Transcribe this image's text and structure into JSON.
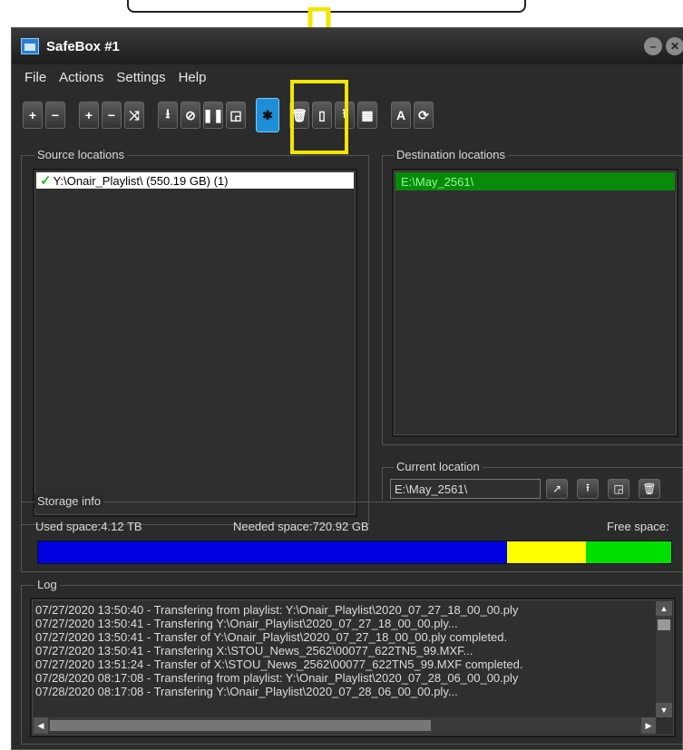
{
  "window": {
    "title": "SafeBox #1"
  },
  "menu": [
    "File",
    "Actions",
    "Settings",
    "Help"
  ],
  "toolbar": {
    "buttons": [
      {
        "icon": "plus-icon",
        "glyph": "+"
      },
      {
        "icon": "minus-icon",
        "glyph": "−"
      },
      {
        "icon": "plus-icon",
        "glyph": "+"
      },
      {
        "icon": "minus-icon",
        "glyph": "−"
      },
      {
        "icon": "shuffle-icon",
        "glyph": "⤨"
      },
      {
        "icon": "download-icon",
        "glyph": "⭳"
      },
      {
        "icon": "stop-icon",
        "glyph": "⊘"
      },
      {
        "icon": "pause-icon",
        "glyph": "❚❚"
      },
      {
        "icon": "window-icon",
        "glyph": "◲"
      },
      {
        "icon": "settings-star-icon",
        "glyph": "✱"
      },
      {
        "icon": "trash-icon",
        "glyph": "🗑"
      },
      {
        "icon": "document-icon",
        "glyph": "▯"
      },
      {
        "icon": "upload-icon",
        "glyph": "⭱"
      },
      {
        "icon": "grid-icon",
        "glyph": "▦"
      },
      {
        "icon": "font-icon",
        "glyph": "A"
      },
      {
        "icon": "refresh-icon",
        "glyph": "⟳"
      }
    ],
    "highlight_color": "#f2e600",
    "active_color": "#1e8fd6"
  },
  "source": {
    "label": "Source locations",
    "items": [
      "Y:\\Onair_Playlist\\ (550.19 GB) (1)"
    ]
  },
  "destination": {
    "label": "Destination locations",
    "items": [
      "E:\\May_2561\\"
    ]
  },
  "current": {
    "label": "Current location",
    "value": "E:\\May_2561\\"
  },
  "storage": {
    "label": "Storage info",
    "used": "Used space:4.12 TB",
    "needed": "Needed space:720.92 GB",
    "free": "Free space:",
    "bar": [
      {
        "color": "#0000e0",
        "fraction": 0.74
      },
      {
        "color": "#ffff00",
        "fraction": 0.126
      },
      {
        "color": "#00e000",
        "fraction": 0.134
      }
    ]
  },
  "log": {
    "label": "Log",
    "lines": [
      "07/27/2020 13:50:40 - Transfering from playlist: Y:\\Onair_Playlist\\2020_07_27_18_00_00.ply",
      "07/27/2020 13:50:41 - Transfering Y:\\Onair_Playlist\\2020_07_27_18_00_00.ply...",
      "07/27/2020 13:50:41 - Transfer of Y:\\Onair_Playlist\\2020_07_27_18_00_00.ply completed.",
      "07/27/2020 13:50:41 - Transfering X:\\STOU_News_2562\\00077_622TN5_99.MXF...",
      "07/27/2020 13:51:24 - Transfer of X:\\STOU_News_2562\\00077_622TN5_99.MXF completed.",
      "07/28/2020 08:17:08 - Transfering from playlist: Y:\\Onair_Playlist\\2020_07_28_06_00_00.ply",
      "07/28/2020 08:17:08 - Transfering Y:\\Onair_Playlist\\2020_07_28_06_00_00.ply..."
    ]
  }
}
